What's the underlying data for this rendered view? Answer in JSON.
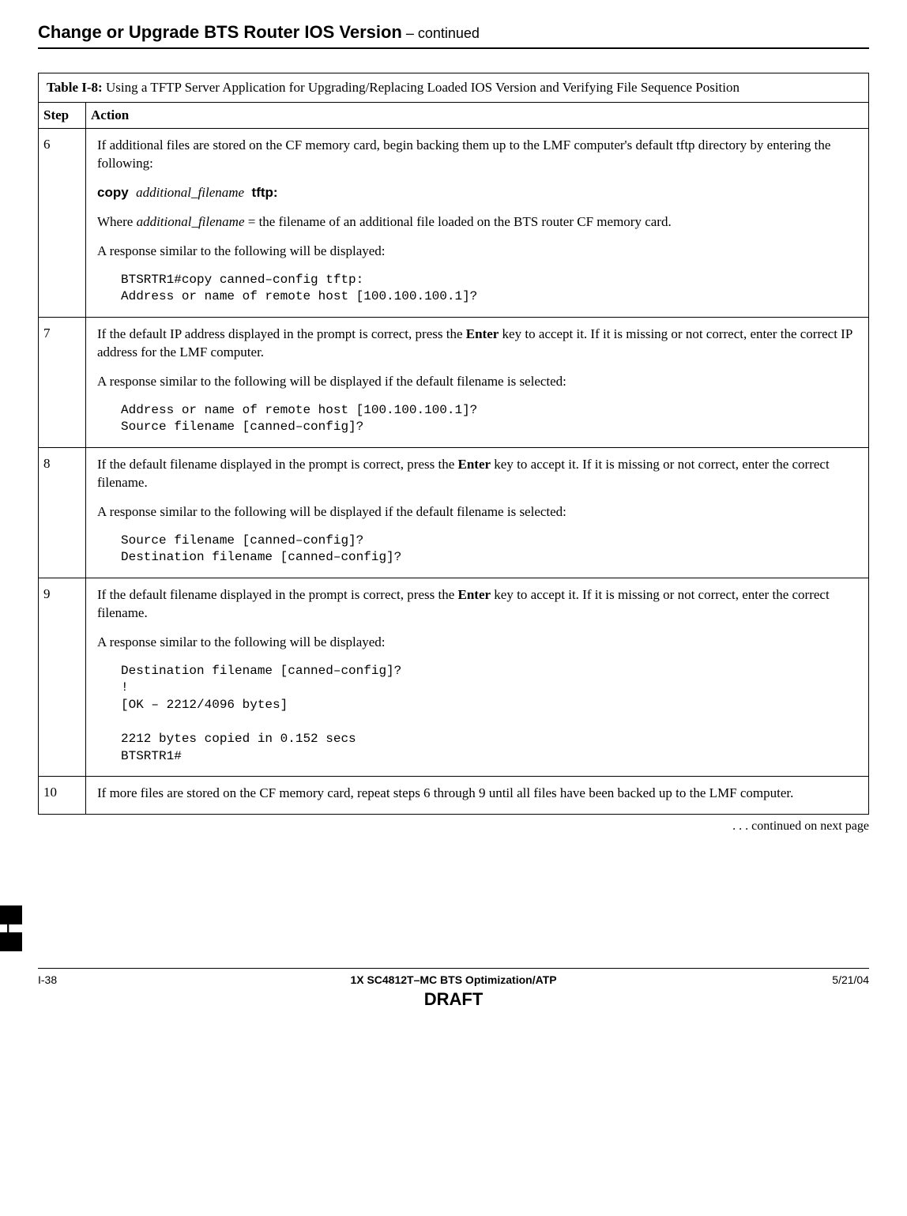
{
  "margin": {
    "letter": "I"
  },
  "header": {
    "title": "Change or Upgrade BTS Router IOS Version",
    "continued": "  – continued"
  },
  "table": {
    "title_strong": "Table I-8:",
    "title_rest": " Using a TFTP Server Application for Upgrading/Replacing Loaded IOS Version and Verifying File Sequence Position",
    "col_step": "Step",
    "col_action": "Action",
    "rows": {
      "r6": {
        "step": "6",
        "p1": "If additional files are stored on the CF memory card, begin backing them up to the LMF computer's default tftp directory by entering the following:",
        "copy_cmd": "copy",
        "copy_arg": "additional_filename",
        "copy_tftp": "tftp:",
        "where_pre": "Where ",
        "where_arg": "additional_filename",
        "where_post": "  =  the filename of an additional file loaded on the BTS router CF memory card.",
        "p2": "A response similar to the following will be displayed:",
        "code": "BTSRTR1#copy canned–config tftp:\nAddress or name of remote host [100.100.100.1]?"
      },
      "r7": {
        "step": "7",
        "p1a": "If the default IP address displayed in the prompt is correct, press the ",
        "enter": "Enter",
        "p1b": " key to accept it. If it is missing or not correct, enter the correct IP address for the LMF computer.",
        "p2": "A response similar to the following will be displayed if the default filename is selected:",
        "code": "Address or name of remote host [100.100.100.1]?\nSource filename [canned–config]?"
      },
      "r8": {
        "step": "8",
        "p1a": "If the default filename displayed in the prompt is correct, press the ",
        "enter": "Enter",
        "p1b": " key to accept it. If it is missing or not correct, enter the correct filename.",
        "p2": "A response similar to the following will be displayed if the default filename is selected:",
        "code": "Source filename [canned–config]?\nDestination filename [canned–config]?"
      },
      "r9": {
        "step": "9",
        "p1a": "If the default filename displayed in the prompt is correct, press the ",
        "enter": "Enter",
        "p1b": " key to accept it. If it is missing or not correct, enter the correct filename.",
        "p2": "A response similar to the following will be displayed:",
        "code": "Destination filename [canned–config]?\n!\n[OK – 2212/4096 bytes]\n\n2212 bytes copied in 0.152 secs\nBTSRTR1#"
      },
      "r10": {
        "step": "10",
        "p1": "If more files are stored on the CF memory card, repeat steps 6 through 9 until all files have been backed up to the LMF computer."
      }
    },
    "continued_next": ". . . continued on next page"
  },
  "footer": {
    "page": "I-38",
    "center": "1X SC4812T–MC BTS Optimization/ATP",
    "draft": "DRAFT",
    "date": "5/21/04"
  }
}
